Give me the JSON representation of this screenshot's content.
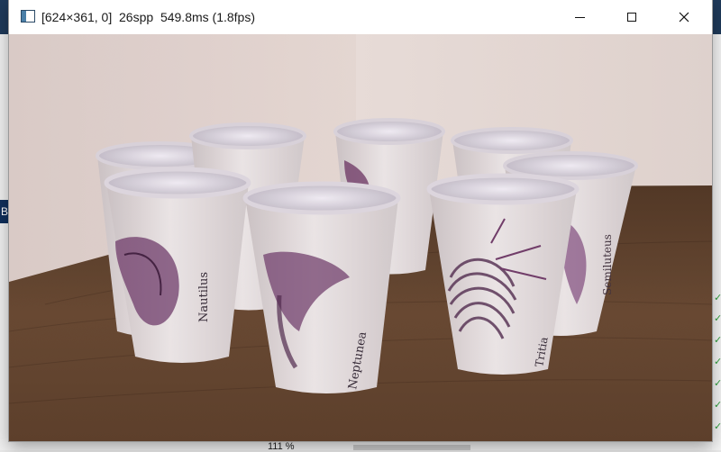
{
  "window": {
    "title": "[624×361, 0]  26spp  549.8ms (1.8fps)"
  },
  "viewport": {
    "render_description": "",
    "cup_labels": [
      "Nautilus",
      "Neptunea",
      "Tritia",
      "Semiluteus"
    ]
  },
  "background": {
    "left_tab_text": "B",
    "zoom_label": "111 %"
  },
  "icons": {
    "app": "app-window-icon",
    "minimize": "minimize-icon",
    "maximize": "maximize-icon",
    "close": "close-icon"
  },
  "colors": {
    "titlebar_bg": "#ffffff",
    "wood_table": "#5a3a22",
    "wall": "#dccfc9",
    "cup_white": "#e4dcdc",
    "print_purple": "#5c2e5a"
  }
}
